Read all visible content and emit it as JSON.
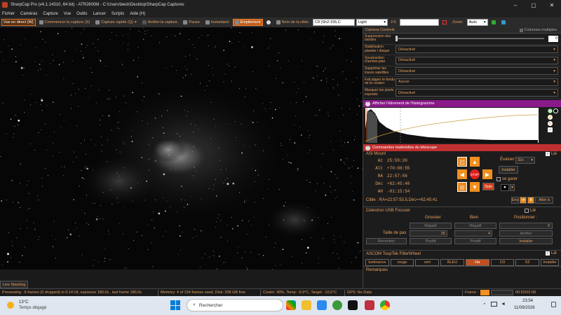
{
  "title": "SharpCap Pro (v4.1.14310, 64 bit) - ATR2600M - C:\\Users\\beck\\Desktop\\SharpCap Captures",
  "menu": [
    "Fichier",
    "Caméras",
    "Capture",
    "Vue",
    "Outils",
    "Lancer",
    "Scripts",
    "Aide (H)"
  ],
  "toolbar": {
    "live": "Vue en direct (W)",
    "start": "Commencer la capture (S)",
    "quick": "Capture rapide (Q)",
    "stop": "Arrêter la capture",
    "pause": "Pause",
    "snapshot": "Instantané",
    "stack": "Empilement",
    "target_label": "Nom de la cible:",
    "target_value": "C9 (Sh2-155,C",
    "mode_value": "Light",
    "fx": "FX",
    "zoom_label": "Zoom:",
    "zoom_value": "Auto"
  },
  "panel": {
    "title": "Camera Controls",
    "multi": "Colonnes multiples",
    "rows": [
      {
        "label": "Suppression des bandes",
        "value": "0"
      },
      {
        "label": "Stabilisation planète / disque",
        "value": "Désactivé"
      },
      {
        "label": "Soustraction d'arrière-plan",
        "value": "Désactivé"
      },
      {
        "label": "Supprimer les traces satellites",
        "value": "Désactivé"
      },
      {
        "label": "Fait pipper le fondu de la «vraie»",
        "value": "Aucun"
      },
      {
        "label": "Masquer les pixels exposés",
        "value": "Désactivé"
      }
    ],
    "histo_title": "Afficher l'étirement de l'histogramme",
    "scope_title": "Commandes matérielles du télescope",
    "mount": {
      "name": "ASI Mount",
      "lie": "Lié",
      "keys": [
        "Az",
        "Alt",
        "RA",
        "Déc",
        "AH"
      ],
      "values": [
        "25:59:20",
        "+70:08:55",
        "22:57:56",
        "+62:45:40",
        "-01:15:54"
      ],
      "eval_label": "Évaluer:",
      "eval_value": "32x",
      "install": "Installer",
      "se_garer": "se garer",
      "stop": "STOP",
      "save": "Suiv",
      "target": "Cible : RA=22:57:53.5,Déc=+62:45:41",
      "ens": "Ens",
      "goto": "Aller à"
    },
    "focuser": {
      "name": "Celestron USB Focuser",
      "lie": "Lié",
      "grosser": "Grossier",
      "bien": "Bien",
      "positionner": "Positionner :",
      "neg1": "Négatif",
      "neg2": "Négatif",
      "pos_value": "0",
      "step_label": "Taille de pas",
      "step1": "25",
      "step2": "4",
      "stop": "Arrêter",
      "recentrer": "Recentrer",
      "pos1": "Positif",
      "pos2": "Positif",
      "install": "Installer"
    },
    "fw": {
      "name": "ASCOM ToupTek FilterWheel",
      "lie": "Lié",
      "filters": [
        "luminance",
        "rouge",
        "vert",
        "BLEU",
        "Ha",
        "O3",
        "S2"
      ],
      "install": "Installer"
    },
    "remarks": "Remarques"
  },
  "live_stack": "Live Stacking",
  "status": {
    "preview": "Previewing : 6 frames (0 dropped) in 0:14:18, exposure 180,0s , last frame 180,0s",
    "memory": "Memory: 4 of 134 frames used, Disk: 208 GB free",
    "cooler": "Cooler: 40%, Temp: -9,9°C, Target: -10,0°C",
    "gps": "GPS: No Data",
    "frame": "Frame :",
    "time": "00:52/02:08"
  },
  "taskbar": {
    "temp": "13°C",
    "weather": "Temps dégagé",
    "search": "Rechercher",
    "clock": "23:54",
    "date": "11/09/2026"
  }
}
